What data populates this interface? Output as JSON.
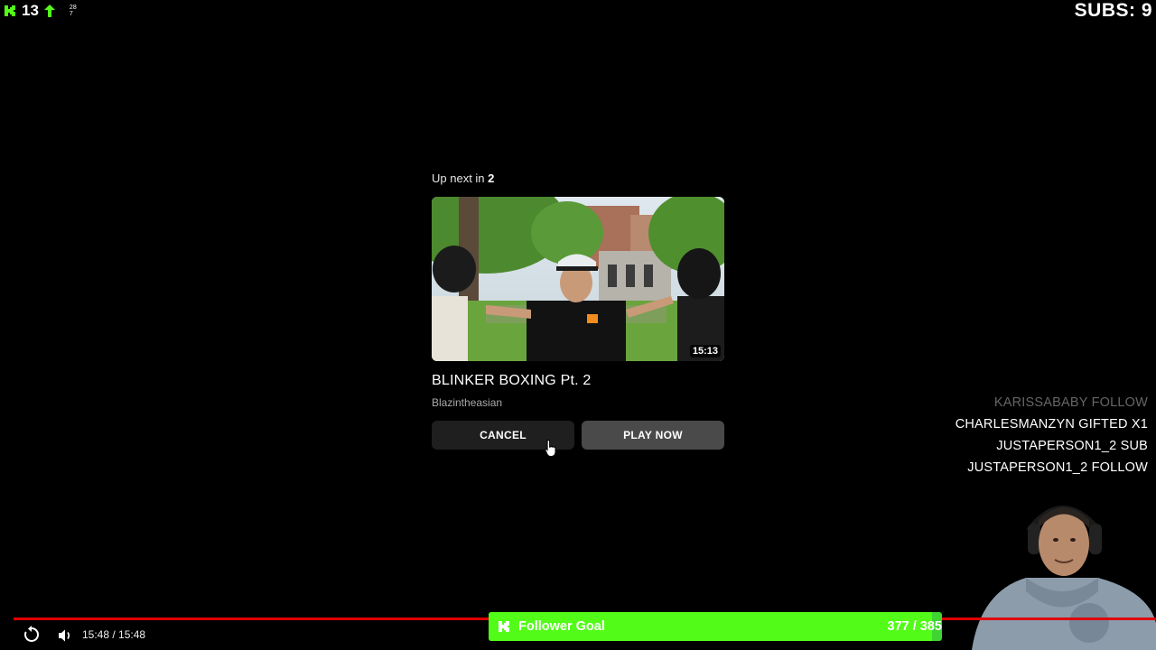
{
  "stream": {
    "viewer_count": "13",
    "tiny_stat_top": "28",
    "tiny_stat_bottom": "7",
    "subs_label": "SUBS: 9"
  },
  "up_next": {
    "label_prefix": "Up next in ",
    "countdown": "2",
    "duration": "15:13",
    "title": "BLINKER BOXING Pt. 2",
    "channel": "Blazintheasian",
    "cancel_label": "CANCEL",
    "play_label": "PLAY NOW"
  },
  "event_feed": [
    {
      "text": "KARISSABABY  FOLLOW",
      "faded": true
    },
    {
      "text": "CHARLESMANZYN  GIFTED X1",
      "faded": false
    },
    {
      "text": "JUSTAPERSON1_2  SUB",
      "faded": false
    },
    {
      "text": "JUSTAPERSON1_2  FOLLOW",
      "faded": false
    }
  ],
  "player": {
    "time_display": "15:48 / 15:48",
    "progress": 1.0
  },
  "follower_goal": {
    "label": "Follower Goal",
    "count_text": "377 / 385",
    "progress": 0.979
  },
  "colors": {
    "kick_green": "#53fc18",
    "progress_red": "#e00000",
    "background": "#000000"
  },
  "icons": [
    "kick-logo-icon",
    "up-arrow-icon",
    "replay-icon",
    "volume-icon",
    "cursor-icon"
  ]
}
